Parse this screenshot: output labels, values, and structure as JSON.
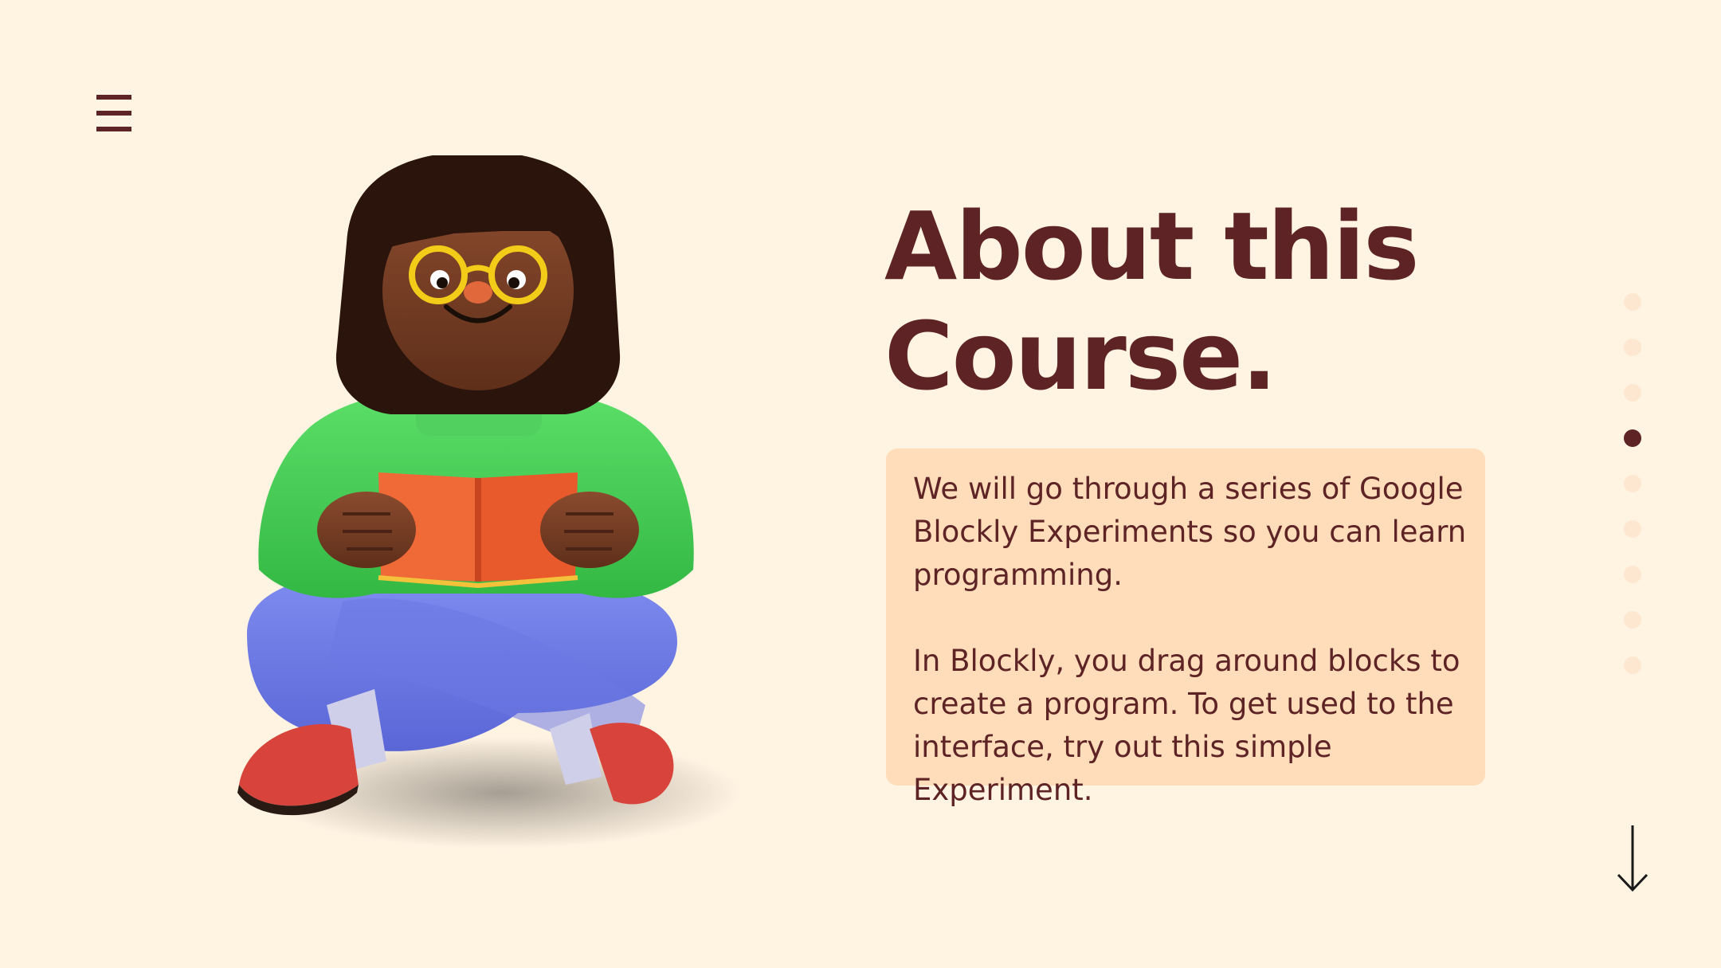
{
  "nav": {
    "menu_icon": "hamburger-menu-icon"
  },
  "hero": {
    "illustration": "girl-reading-book-illustration",
    "title_line_1": "About this",
    "title_line_2": "Course."
  },
  "card": {
    "paragraph_1": "We will go through a series of Google Blockly Experiments so you can learn programming.",
    "paragraph_2": "In Blockly, you drag around blocks to create a program. To get used to the interface, try out this simple Experiment."
  },
  "pagination": {
    "total": 9,
    "active_index": 3
  },
  "scroll": {
    "icon": "arrow-down-icon"
  },
  "colors": {
    "background": "#FFF3E2",
    "text": "#5E2325",
    "card": "#FFDDBA",
    "dot_inactive": "#FDE7D0",
    "dot_active": "#5E2325"
  }
}
